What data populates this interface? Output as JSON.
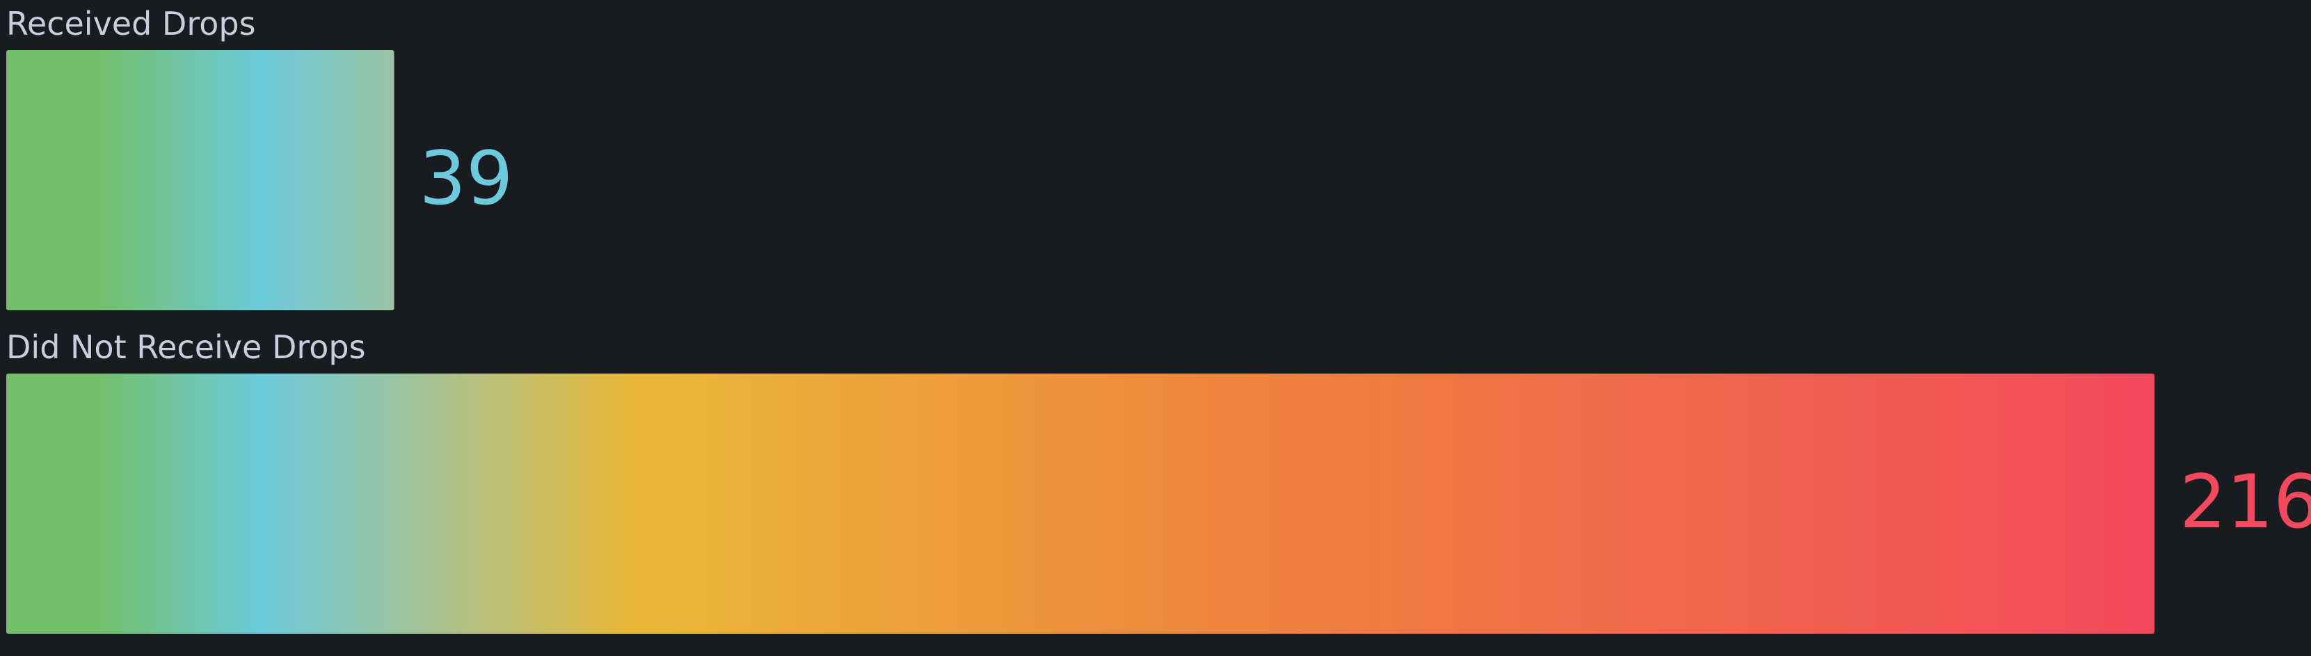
{
  "chart_data": {
    "type": "bar",
    "orientation": "horizontal",
    "display": "bar-gauge",
    "categories": [
      "Received Drops",
      "Did Not Receive Drops"
    ],
    "values": [
      39,
      216
    ],
    "value_labels": [
      "39",
      "216"
    ],
    "xlim": [
      0,
      216
    ],
    "value_colors": [
      "#6ccadc",
      "#f2495c"
    ],
    "color_scale": [
      "#73bf69",
      "#6ccadc",
      "#eab839",
      "#ef843c",
      "#f2495c"
    ],
    "title": "",
    "xlabel": "",
    "ylabel": "",
    "grid": false,
    "legend": "none"
  }
}
